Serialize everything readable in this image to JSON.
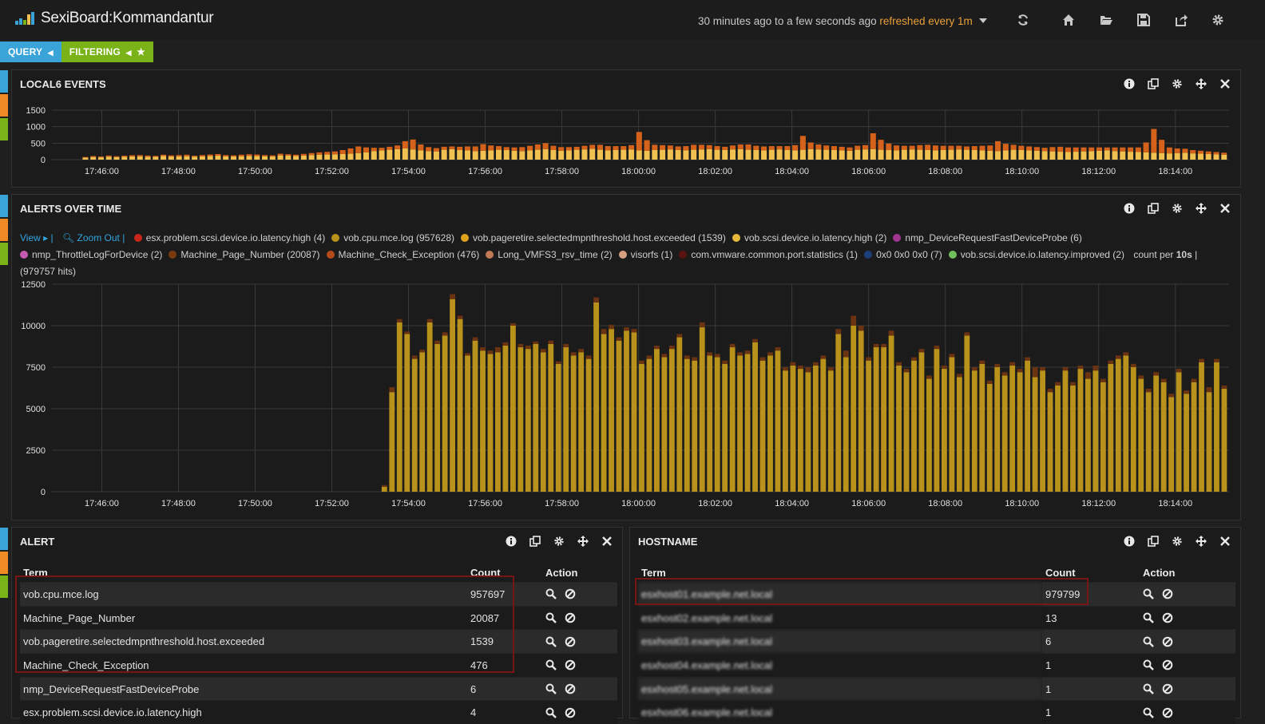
{
  "app": {
    "title": "SexiBoard:Kommandantur",
    "time_range": "30 minutes ago to a few seconds ago",
    "refresh": "refreshed every 1m"
  },
  "pills": {
    "query": "QUERY",
    "filtering": "FILTERING"
  },
  "lanes": {
    "colors": [
      "#3aa4d8",
      "#f08a24",
      "#7ab317"
    ]
  },
  "topbar_icons": [
    "refresh-icon",
    "home-icon",
    "folder-open-icon",
    "save-icon",
    "share-icon",
    "gear-icon"
  ],
  "panels": {
    "local6": {
      "title": "LOCAL6 EVENTS",
      "chart_data": {
        "type": "bar",
        "y_ticks": [
          0,
          500,
          1000,
          1500
        ],
        "ylim": [
          0,
          1500
        ],
        "x_ticks": [
          "17:46:00",
          "17:48:00",
          "17:50:00",
          "17:52:00",
          "17:54:00",
          "17:56:00",
          "17:58:00",
          "18:00:00",
          "18:02:00",
          "18:04:00",
          "18:06:00",
          "18:08:00",
          "18:10:00",
          "18:12:00",
          "18:14:00"
        ],
        "x_tick_minutes": [
          0,
          2,
          4,
          6,
          8,
          10,
          12,
          14,
          16,
          18,
          20,
          22,
          24,
          26,
          28
        ],
        "x_range_minutes": [
          -1.3,
          29.4
        ],
        "series": [
          {
            "color": "#f0c050",
            "values": [
              60,
              80,
              70,
              90,
              75,
              85,
              95,
              100,
              90,
              85,
              110,
              95,
              100,
              105,
              90,
              100,
              110,
              120,
              100,
              95,
              105,
              115,
              110,
              100,
              95,
              130,
              120,
              110,
              125,
              140,
              150,
              155,
              160,
              170,
              180,
              200,
              220,
              260,
              280,
              300,
              320,
              340,
              310,
              280,
              260,
              250,
              300,
              320,
              290,
              280,
              260,
              270,
              280,
              300,
              290,
              270,
              260,
              280,
              300,
              320,
              290,
              270,
              280,
              300,
              310,
              330,
              300,
              280,
              290,
              300,
              310,
              280,
              270,
              290,
              300,
              310,
              290,
              280,
              300,
              310,
              320,
              300,
              290,
              310,
              320,
              300,
              290,
              280,
              300,
              310,
              290,
              280,
              300,
              320,
              310,
              300,
              290,
              280,
              270,
              300,
              310,
              320,
              300,
              290,
              280,
              300,
              310,
              300,
              290,
              280,
              290,
              300,
              310,
              300,
              290,
              280,
              270,
              260,
              280,
              300,
              290,
              280,
              270,
              260,
              250,
              240,
              230,
              240,
              250,
              260,
              270,
              280,
              260,
              250,
              240,
              230,
              220,
              210,
              200,
              190,
              200,
              210,
              190,
              180,
              170,
              160,
              150
            ]
          },
          {
            "color": "#d4621a",
            "values": [
              20,
              30,
              25,
              35,
              30,
              35,
              40,
              40,
              35,
              30,
              40,
              35,
              40,
              45,
              30,
              40,
              45,
              50,
              40,
              35,
              45,
              50,
              45,
              40,
              35,
              50,
              45,
              40,
              50,
              60,
              70,
              80,
              90,
              120,
              160,
              200,
              150,
              100,
              80,
              90,
              110,
              220,
              300,
              180,
              120,
              100,
              90,
              80,
              100,
              120,
              140,
              200,
              150,
              110,
              90,
              100,
              120,
              140,
              160,
              180,
              130,
              110,
              100,
              90,
              110,
              120,
              150,
              130,
              120,
              110,
              130,
              560,
              320,
              160,
              140,
              120,
              110,
              130,
              150,
              140,
              120,
              110,
              100,
              120,
              140,
              160,
              130,
              120,
              110,
              100,
              120,
              160,
              420,
              200,
              150,
              130,
              120,
              110,
              100,
              120,
              130,
              480,
              300,
              200,
              150,
              120,
              110,
              140,
              160,
              150,
              130,
              120,
              110,
              100,
              120,
              140,
              160,
              300,
              200,
              150,
              130,
              120,
              110,
              100,
              130,
              150,
              140,
              130,
              120,
              110,
              100,
              90,
              110,
              120,
              130,
              140,
              300,
              720,
              400,
              180,
              140,
              120,
              100,
              90,
              80,
              70,
              60
            ]
          }
        ]
      }
    },
    "alerts": {
      "title": "ALERTS OVER TIME",
      "legend_view": "View ▸ |",
      "legend_zoom": "Zoom Out |",
      "legend": [
        {
          "label": "esx.problem.scsi.device.io.latency.high (4)",
          "color": "#c8261b"
        },
        {
          "label": "vob.cpu.mce.log (957628)",
          "color": "#b8921a"
        },
        {
          "label": "vob.pageretire.selectedmpnthreshold.host.exceeded (1539)",
          "color": "#e0a11b"
        },
        {
          "label": "vob.scsi.device.io.latency.high (2)",
          "color": "#e6b93a"
        },
        {
          "label": "nmp_DeviceRequestFastDeviceProbe (6)",
          "color": "#a0368f"
        },
        {
          "label": "nmp_ThrottleLogForDevice (2)",
          "color": "#c45aaf"
        },
        {
          "label": "Machine_Page_Number (20087)",
          "color": "#7a3a10"
        },
        {
          "label": "Machine_Check_Exception (476)",
          "color": "#b64a1a"
        },
        {
          "label": "Long_VMFS3_rsv_time (2)",
          "color": "#c07a55"
        },
        {
          "label": "visorfs (1)",
          "color": "#d8a080"
        },
        {
          "label": "com.vmware.common.port.statistics (1)",
          "color": "#5a1410"
        },
        {
          "label": "0x0 0x0 0x0 (7)",
          "color": "#1a3f7a"
        },
        {
          "label": "vob.scsi.device.io.latency.improved (2)",
          "color": "#6fbf5a"
        }
      ],
      "legend_count_prefix": "count per",
      "legend_count_bold": "10s",
      "legend_count_suffix": "|",
      "legend_hits": "(979757 hits)",
      "chart_data": {
        "type": "bar",
        "y_ticks": [
          0,
          2500,
          5000,
          7500,
          10000,
          12500
        ],
        "ylim": [
          0,
          12500
        ],
        "x_ticks": [
          "17:46:00",
          "17:48:00",
          "17:50:00",
          "17:52:00",
          "17:54:00",
          "17:56:00",
          "17:58:00",
          "18:00:00",
          "18:02:00",
          "18:04:00",
          "18:06:00",
          "18:08:00",
          "18:10:00",
          "18:12:00",
          "18:14:00"
        ],
        "x_tick_minutes": [
          0,
          2,
          4,
          6,
          8,
          10,
          12,
          14,
          16,
          18,
          20,
          22,
          24,
          26,
          28
        ],
        "x_range_minutes": [
          -1.3,
          29.4
        ],
        "series": [
          {
            "name": "vob.cpu.mce.log",
            "color": "#b8921a",
            "values": [
              300,
              6000,
              10200,
              9500,
              8000,
              8400,
              10200,
              8900,
              9400,
              11600,
              10400,
              8200,
              9100,
              8500,
              8300,
              8400,
              8800,
              10000,
              8700,
              8600,
              8900,
              8400,
              8900,
              7700,
              8700,
              8200,
              8400,
              8000,
              11400,
              9500,
              9800,
              9100,
              9700,
              9600,
              7700,
              8000,
              8600,
              8100,
              8600,
              9300,
              8000,
              7900,
              9900,
              8200,
              8100,
              7700,
              8700,
              8200,
              8300,
              9000,
              7900,
              8200,
              8500,
              7300,
              7600,
              7400,
              7200,
              7600,
              8000,
              7300,
              9500,
              8100,
              10000,
              9700,
              7900,
              8700,
              8700,
              9400,
              7600,
              7200,
              7900,
              8400,
              6800,
              8600,
              7400,
              8100,
              6900,
              9400,
              7300,
              7700,
              6500,
              7500,
              7000,
              7600,
              7200,
              7900,
              6900,
              7300,
              6000,
              6400,
              7300,
              6400,
              7400,
              6800,
              7300,
              6600,
              7700,
              8000,
              8200,
              7500,
              6800,
              6000,
              7000,
              6600,
              5700,
              7200,
              5900,
              6600,
              7800,
              6000,
              7800,
              6200
            ]
          },
          {
            "name": "Machine_Page_Number",
            "color": "#6b3312",
            "values": [
              100,
              300,
              200,
              150,
              200,
              150,
              200,
              200,
              200,
              300,
              200,
              150,
              200,
              200,
              200,
              300,
              200,
              150,
              200,
              200,
              150,
              200,
              200,
              150,
              200,
              200,
              200,
              200,
              300,
              300,
              250,
              200,
              200,
              200,
              200,
              200,
              200,
              200,
              200,
              200,
              200,
              200,
              300,
              200,
              200,
              200,
              200,
              200,
              200,
              200,
              200,
              200,
              200,
              200,
              200,
              200,
              300,
              200,
              200,
              200,
              300,
              400,
              600,
              300,
              200,
              200,
              200,
              300,
              200,
              200,
              200,
              200,
              200,
              200,
              200,
              200,
              200,
              200,
              200,
              200,
              200,
              200,
              200,
              200,
              200,
              200,
              600,
              200,
              200,
              200,
              200,
              200,
              200,
              400,
              300,
              200,
              200,
              200,
              200,
              200,
              200,
              200,
              200,
              200,
              200,
              200,
              200,
              200,
              200,
              300,
              200,
              200
            ]
          },
          {
            "name": "Machine_Check_Exception",
            "color": "#b64a1a",
            "values": [
              0,
              0,
              0,
              0,
              0,
              0,
              0,
              0,
              0,
              0,
              0,
              0,
              0,
              0,
              0,
              0,
              0,
              0,
              0,
              0,
              0,
              0,
              0,
              0,
              0,
              0,
              0,
              0,
              0,
              0,
              0,
              0,
              0,
              0,
              0,
              0,
              0,
              0,
              0,
              0,
              0,
              0,
              0,
              0,
              0,
              0,
              0,
              0,
              0,
              0,
              0,
              0,
              0,
              0,
              0,
              0,
              0,
              0,
              0,
              0,
              0,
              0,
              0,
              0,
              0,
              0,
              0,
              0,
              0,
              0,
              0,
              0,
              0,
              0,
              0,
              0,
              0,
              0,
              0,
              0,
              0,
              0,
              0,
              0,
              0,
              0,
              0,
              0,
              0,
              0,
              0,
              0,
              0,
              0,
              0,
              0,
              0,
              0,
              0,
              0,
              0,
              0,
              0,
              0,
              0,
              0,
              0,
              0,
              0,
              0,
              0,
              0
            ]
          }
        ]
      }
    },
    "alert": {
      "title": "ALERT",
      "headers": {
        "term": "Term",
        "count": "Count",
        "action": "Action"
      },
      "rows": [
        {
          "term": "vob.cpu.mce.log",
          "count": "957697"
        },
        {
          "term": "Machine_Page_Number",
          "count": "20087"
        },
        {
          "term": "vob.pageretire.selectedmpnthreshold.host.exceeded",
          "count": "1539"
        },
        {
          "term": "Machine_Check_Exception",
          "count": "476"
        },
        {
          "term": "nmp_DeviceRequestFastDeviceProbe",
          "count": "6"
        },
        {
          "term": "esx.problem.scsi.device.io.latency.high",
          "count": "4"
        }
      ]
    },
    "hostname": {
      "title": "HOSTNAME",
      "headers": {
        "term": "Term",
        "count": "Count",
        "action": "Action"
      },
      "rows": [
        {
          "term": "esxhost01.example.net.local",
          "count": "979799"
        },
        {
          "term": "esxhost02.example.net.local",
          "count": "13"
        },
        {
          "term": "esxhost03.example.net.local",
          "count": "6"
        },
        {
          "term": "esxhost04.example.net.local",
          "count": "1"
        },
        {
          "term": "esxhost05.example.net.local",
          "count": "1"
        },
        {
          "term": "esxhost06.example.net.local",
          "count": "1"
        }
      ]
    }
  }
}
